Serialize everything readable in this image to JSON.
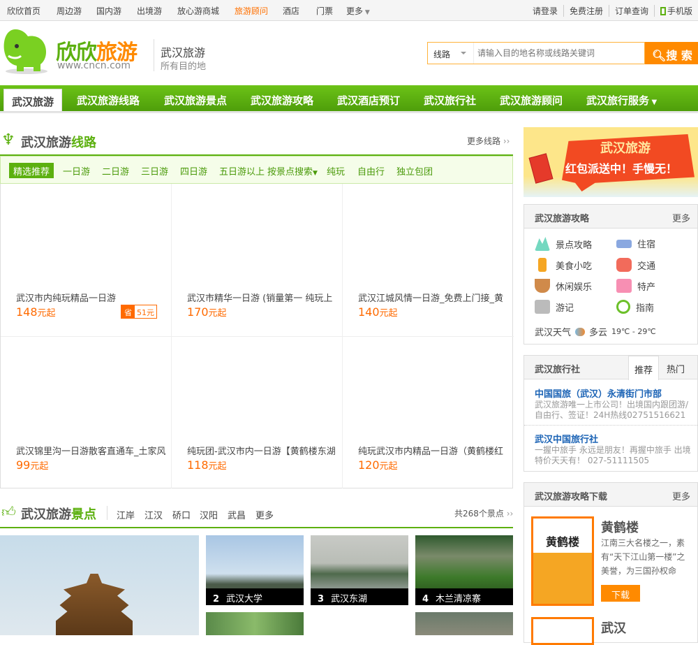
{
  "topbar": {
    "links": [
      "欣欣首页",
      "周边游",
      "国内游",
      "出境游",
      "放心游商城",
      "旅游顾问",
      "酒店",
      "门票",
      "更多"
    ],
    "right": [
      "请登录",
      "免费注册",
      "订单查询",
      "手机版"
    ]
  },
  "header": {
    "logo_cn_green": "欣欣",
    "logo_cn_orange": "旅游",
    "logo_url": "www.cncn.com",
    "city": "武汉旅游",
    "city_sub": "所有目的地",
    "search_type": "线路",
    "search_placeholder": "请输入目的地名称或线路关键词",
    "search_button": "搜 索"
  },
  "nav": [
    "武汉旅游",
    "武汉旅游线路",
    "武汉旅游景点",
    "武汉旅游攻略",
    "武汉酒店预订",
    "武汉旅行社",
    "武汉旅游顾问",
    "武汉旅行服务"
  ],
  "routes": {
    "title_a": "武汉旅游",
    "title_b": "线路",
    "more": "更多线路",
    "filters": [
      "精选推荐",
      "一日游",
      "二日游",
      "三日游",
      "四日游",
      "五日游以上",
      "按景点搜索",
      "纯玩",
      "自由行",
      "独立包团"
    ],
    "cards": [
      {
        "title": "武汉市内纯玩精品一日游",
        "price": "148",
        "unit": "元起",
        "save_label": "省",
        "save": "51元"
      },
      {
        "title": "武汉市精华一日游 (销量第一 纯玩上",
        "price": "170",
        "unit": "元起"
      },
      {
        "title": "武汉江城风情一日游_免费上门接_黄",
        "price": "140",
        "unit": "元起"
      },
      {
        "title": "武汉锦里沟一日游散客直通车_土家风",
        "price": "99",
        "unit": "元起"
      },
      {
        "title": "纯玩团-武汉市内一日游【黄鹤楼东湖",
        "price": "118",
        "unit": "元起"
      },
      {
        "title": "纯玩武汉市内精品一日游（黄鹤楼红",
        "price": "120",
        "unit": "元起"
      }
    ]
  },
  "scenic": {
    "title_a": "武汉旅游",
    "title_b": "景点",
    "tabs": [
      "江岸",
      "江汉",
      "硚口",
      "汉阳",
      "武昌",
      "更多"
    ],
    "count": "共268个景点",
    "photos": [
      {
        "num": "2",
        "name": "武汉大学"
      },
      {
        "num": "3",
        "name": "武汉东湖"
      },
      {
        "num": "4",
        "name": "木兰清凉寨"
      }
    ]
  },
  "banner": {
    "line1": "武汉旅游",
    "line2": "红包派送中！手慢无！"
  },
  "guide": {
    "title": "武汉旅游攻略",
    "more": "更多",
    "items": [
      "景点攻略",
      "住宿",
      "美食小吃",
      "交通",
      "休闲娱乐",
      "特产",
      "游记",
      "指南"
    ],
    "weather_label": "武汉天气",
    "weather": "多云",
    "temp": "19℃ - 29℃"
  },
  "agency": {
    "title": "武汉旅行社",
    "tabs": [
      "推荐",
      "热门"
    ],
    "items": [
      {
        "name": "中国国旅（武汉）永清街门市部",
        "desc": "武汉旅游唯一上市公司！出境国内跟团游/自由行、签证！24H热线02751516621"
      },
      {
        "name": "武汉中国旅行社",
        "desc": "一握中旅手 永远是朋友！再握中旅手 出境特价天天有！ 027-51111505"
      }
    ]
  },
  "download": {
    "title": "武汉旅游攻略下载",
    "more": "更多",
    "items": [
      {
        "name": "黄鹤楼",
        "desc": "江南三大名楼之一，素有“天下江山第一楼”之美誉，为三国孙权命",
        "button": "下载"
      },
      {
        "name": "武汉"
      }
    ]
  }
}
